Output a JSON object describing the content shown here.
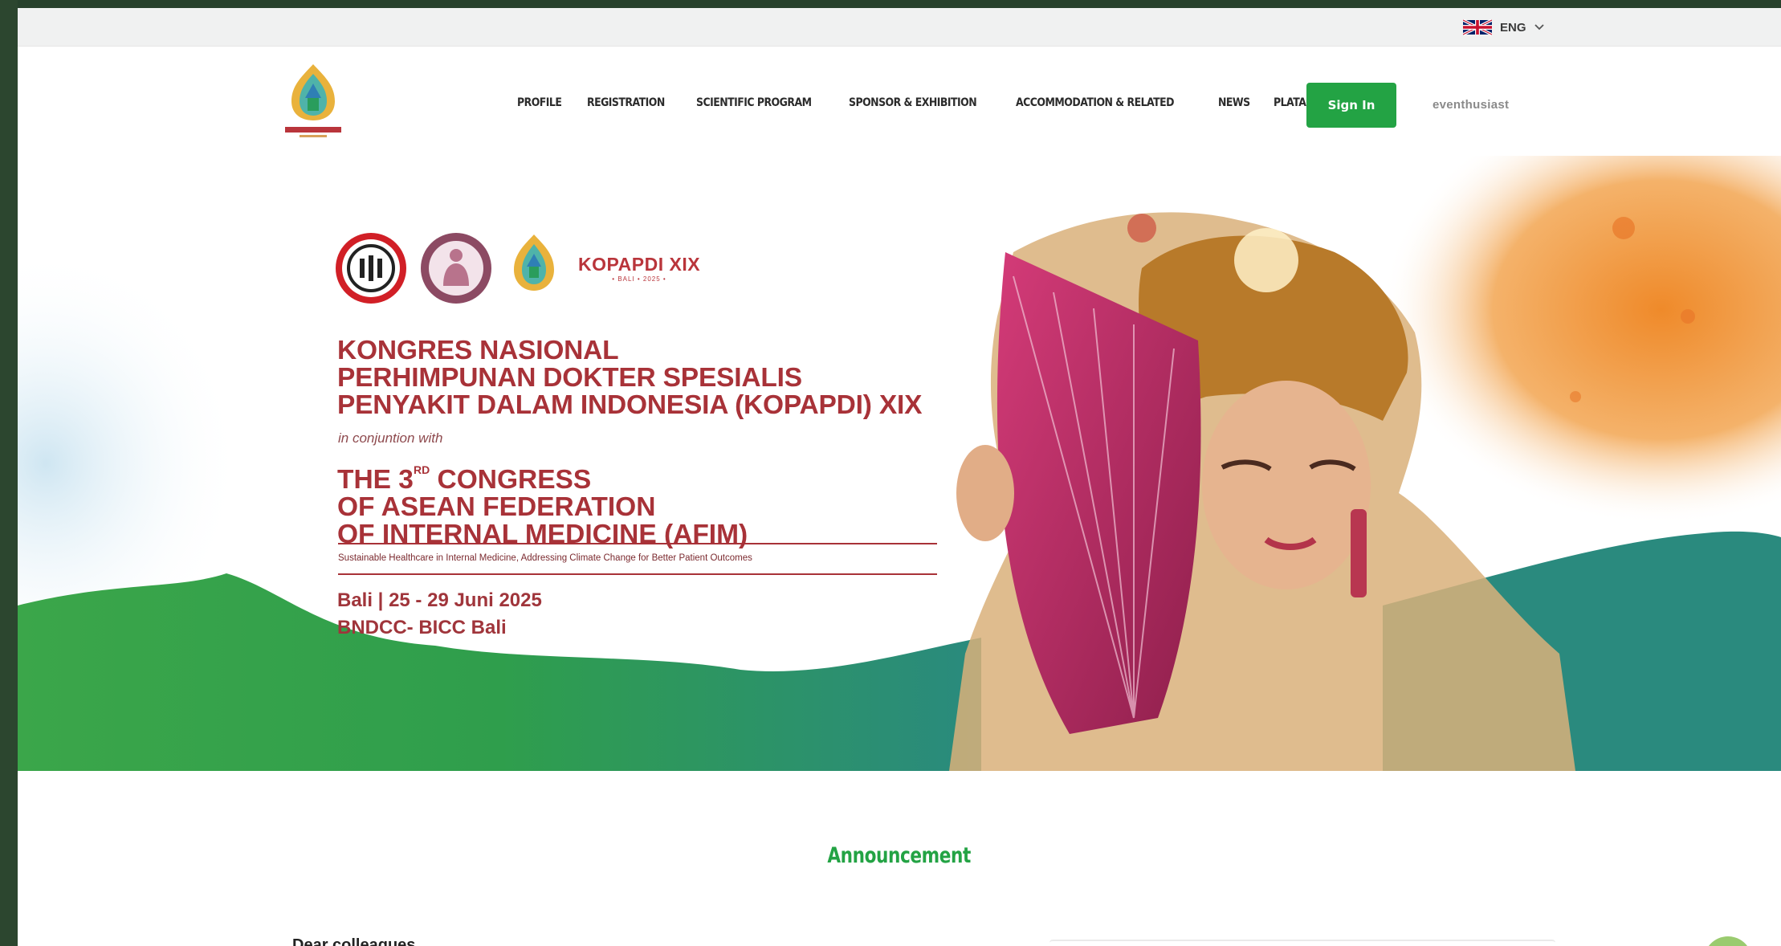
{
  "langbar": {
    "language": "ENG",
    "flag_icon": "uk-flag-icon"
  },
  "header": {
    "logo_text": "KOPAPDI XIX",
    "nav": [
      "PROFILE",
      "REGISTRATION",
      "SCIENTIFIC PROGRAM",
      "SPONSOR & EXHIBITION",
      "ACCOMMODATION & RELATED",
      "NEWS",
      "PLATARAN SEHAT"
    ],
    "signin_label": "Sign In",
    "brand": "eventhusiast"
  },
  "hero": {
    "kop_name": "KOPAPDI XIX",
    "kop_sub": "• BALI • 2025 •",
    "title_lines": [
      "KONGRES NASIONAL",
      "PERHIMPUNAN DOKTER SPESIALIS",
      "PENYAKIT DALAM INDONESIA (KOPAPDI) XIX"
    ],
    "conjunction": "in conjuntion with",
    "title2_prefix": "THE 3",
    "title2_sup": "RD",
    "title2_suffix": " CONGRESS",
    "title2_lines": [
      "OF ASEAN FEDERATION",
      "OF INTERNAL MEDICINE (AFIM)"
    ],
    "tagline": "Sustainable Healthcare in Internal Medicine, Addressing Climate Change for Better Patient Outcomes",
    "dates": "Bali | 25 - 29 Juni 2025",
    "venue": "BNDCC- BICC Bali"
  },
  "announcement": {
    "heading": "Announcement",
    "greeting": "Dear colleagues"
  },
  "colors": {
    "brand_green": "#23a344",
    "title_red": "#a83238"
  }
}
